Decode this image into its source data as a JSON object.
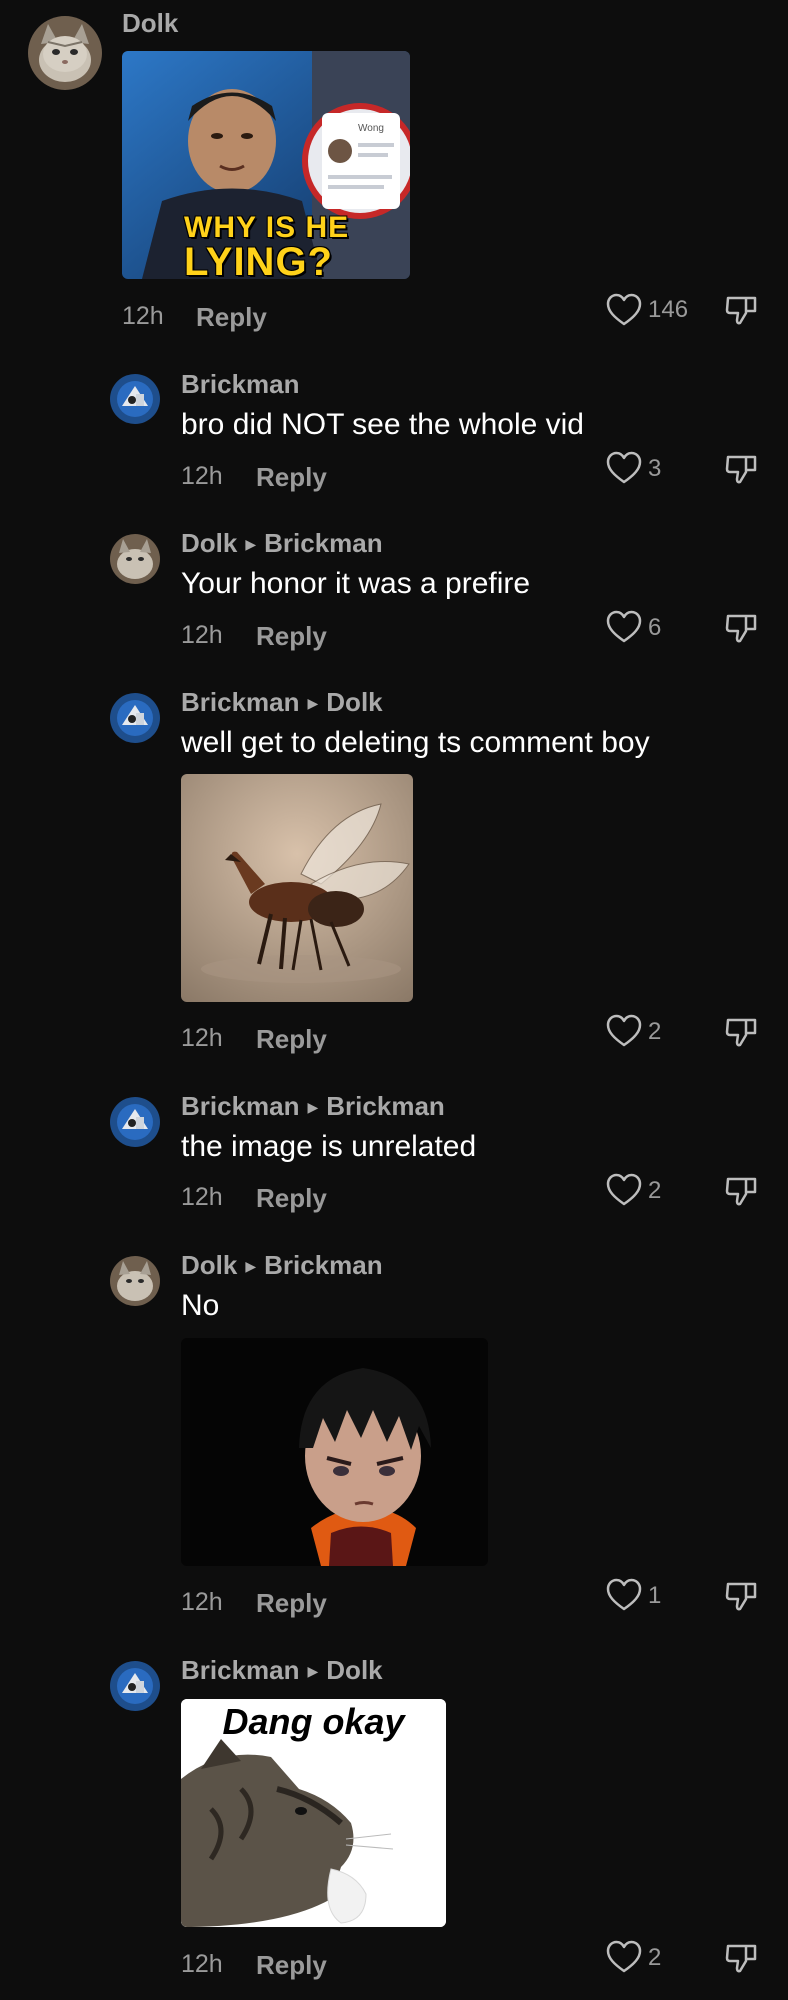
{
  "comments": [
    {
      "author": "Dolk",
      "reply_to": "",
      "text": "",
      "media_caption_1": "WHY IS HE",
      "media_caption_2": "LYING?",
      "phone_label": "Wong",
      "time": "12h",
      "reply_label": "Reply",
      "likes": "146"
    },
    {
      "author": "Brickman",
      "reply_to": "",
      "text": "bro did NOT see the whole vid",
      "time": "12h",
      "reply_label": "Reply",
      "likes": "3"
    },
    {
      "author": "Dolk",
      "reply_to": "Brickman",
      "text": "Your honor it was a prefire",
      "time": "12h",
      "reply_label": "Reply",
      "likes": "6"
    },
    {
      "author": "Brickman",
      "reply_to": "Dolk",
      "text": "well get to deleting ts comment boy",
      "time": "12h",
      "reply_label": "Reply",
      "likes": "2"
    },
    {
      "author": "Brickman",
      "reply_to": "Brickman",
      "text": "the image is unrelated",
      "time": "12h",
      "reply_label": "Reply",
      "likes": "2"
    },
    {
      "author": "Dolk",
      "reply_to": "Brickman",
      "text": "No",
      "time": "12h",
      "reply_label": "Reply",
      "likes": "1"
    },
    {
      "author": "Brickman",
      "reply_to": "Dolk",
      "text": "",
      "media_caption": "Dang okay",
      "time": "12h",
      "reply_label": "Reply",
      "likes": "2"
    }
  ],
  "icons": {
    "like": "heart-icon",
    "dislike": "thumbs-down-icon",
    "reply_arrow": "triangle-right-icon"
  },
  "colors": {
    "background": "#0d0d0d",
    "name": "#a9a9a9",
    "body_text": "#ffffff",
    "meta": "#9a9a9a"
  }
}
